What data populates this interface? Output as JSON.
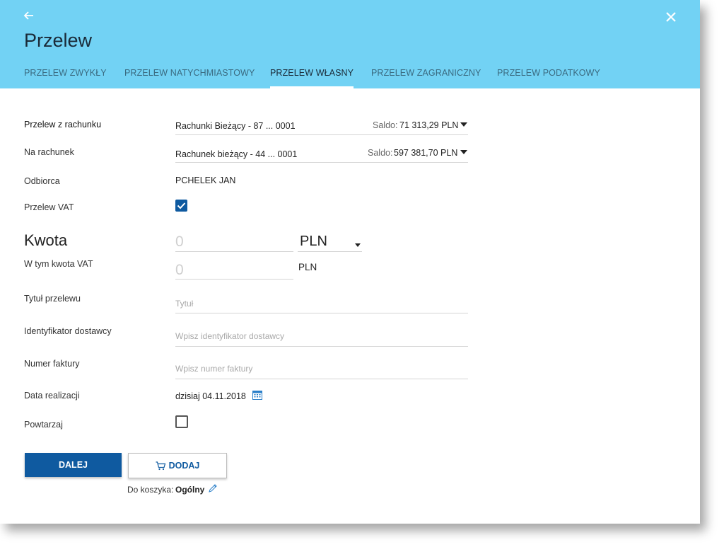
{
  "header": {
    "title": "Przelew",
    "tabs": [
      {
        "label": "PRZELEW ZWYKŁY"
      },
      {
        "label": "PRZELEW NATYCHMIASTOWY"
      },
      {
        "label": "PRZELEW WŁASNY"
      },
      {
        "label": "PRZELEW ZAGRANICZNY"
      },
      {
        "label": "PRZELEW PODATKOWY"
      }
    ]
  },
  "form": {
    "from_account": {
      "label": "Przelew z rachunku",
      "value": "Rachunki Bieżący - 87 ... 0001",
      "saldo_label": "Saldo:",
      "saldo_value": "71 313,29 PLN"
    },
    "to_account": {
      "label": "Na rachunek",
      "value": "Rachunek bieżący - 44 ... 0001",
      "saldo_label": "Saldo:",
      "saldo_value": "597 381,70 PLN"
    },
    "recipient": {
      "label": "Odbiorca",
      "value": "PCHELEK JAN"
    },
    "vat": {
      "label": "Przelew VAT",
      "checked": true
    },
    "amount": {
      "label": "Kwota",
      "placeholder": "0",
      "currency": "PLN"
    },
    "vat_amount": {
      "label": "W tym kwota VAT",
      "placeholder": "0",
      "currency": "PLN"
    },
    "title": {
      "label": "Tytuł przelewu",
      "placeholder": "Tytuł"
    },
    "supplier_id": {
      "label": "Identyfikator dostawcy",
      "placeholder": "Wpisz identyfikator dostawcy"
    },
    "invoice": {
      "label": "Numer faktury",
      "placeholder": "Wpisz numer faktury"
    },
    "date": {
      "label": "Data realizacji",
      "value": "dzisiaj 04.11.2018"
    },
    "repeat": {
      "label": "Powtarzaj",
      "checked": false
    }
  },
  "actions": {
    "next_label": "DALEJ",
    "add_label": "DODAJ",
    "cart_prefix": "Do koszyka:",
    "cart_value": "Ogólny"
  },
  "colors": {
    "header": "#72d2f4",
    "primary": "#0f5aa0"
  }
}
